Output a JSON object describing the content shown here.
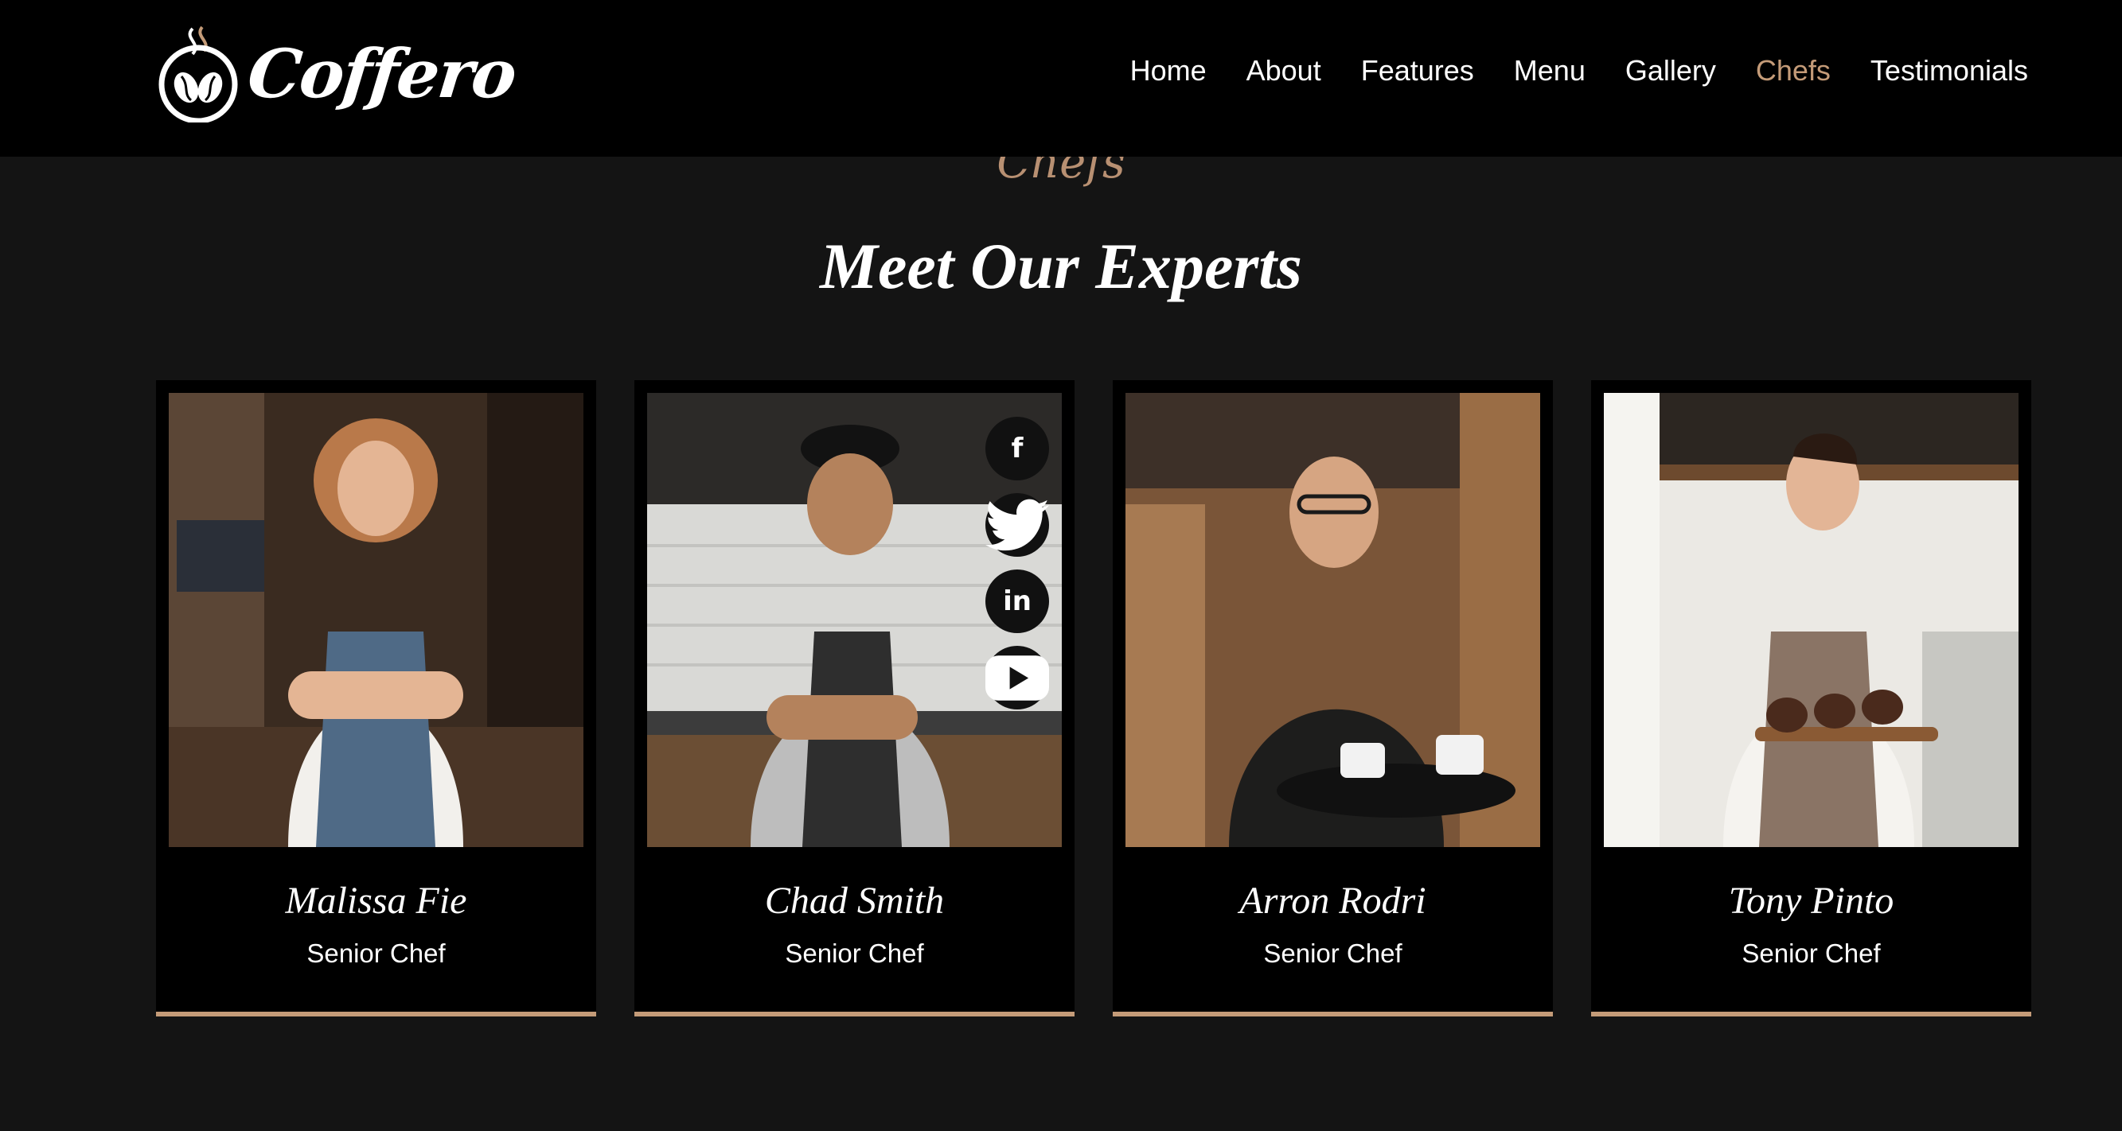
{
  "brand": {
    "name": "Coffero",
    "logo_icon": "coffee-bean-cup-icon"
  },
  "nav": {
    "items": [
      "Home",
      "About",
      "Features",
      "Menu",
      "Gallery",
      "Chefs",
      "Testimonials"
    ],
    "active": "Chefs"
  },
  "section": {
    "eyebrow": "Chefs",
    "title": "Meet Our Experts"
  },
  "chefs": [
    {
      "name": "Malissa Fie",
      "role": "Senior Chef"
    },
    {
      "name": "Chad Smith",
      "role": "Senior Chef"
    },
    {
      "name": "Arron Rodri",
      "role": "Senior Chef"
    },
    {
      "name": "Tony Pinto",
      "role": "Senior Chef"
    }
  ],
  "social_icons": [
    "facebook-icon",
    "twitter-icon",
    "linkedin-icon",
    "youtube-icon"
  ],
  "colors": {
    "accent": "#c49b78",
    "background": "#141414",
    "header": "#000000"
  }
}
